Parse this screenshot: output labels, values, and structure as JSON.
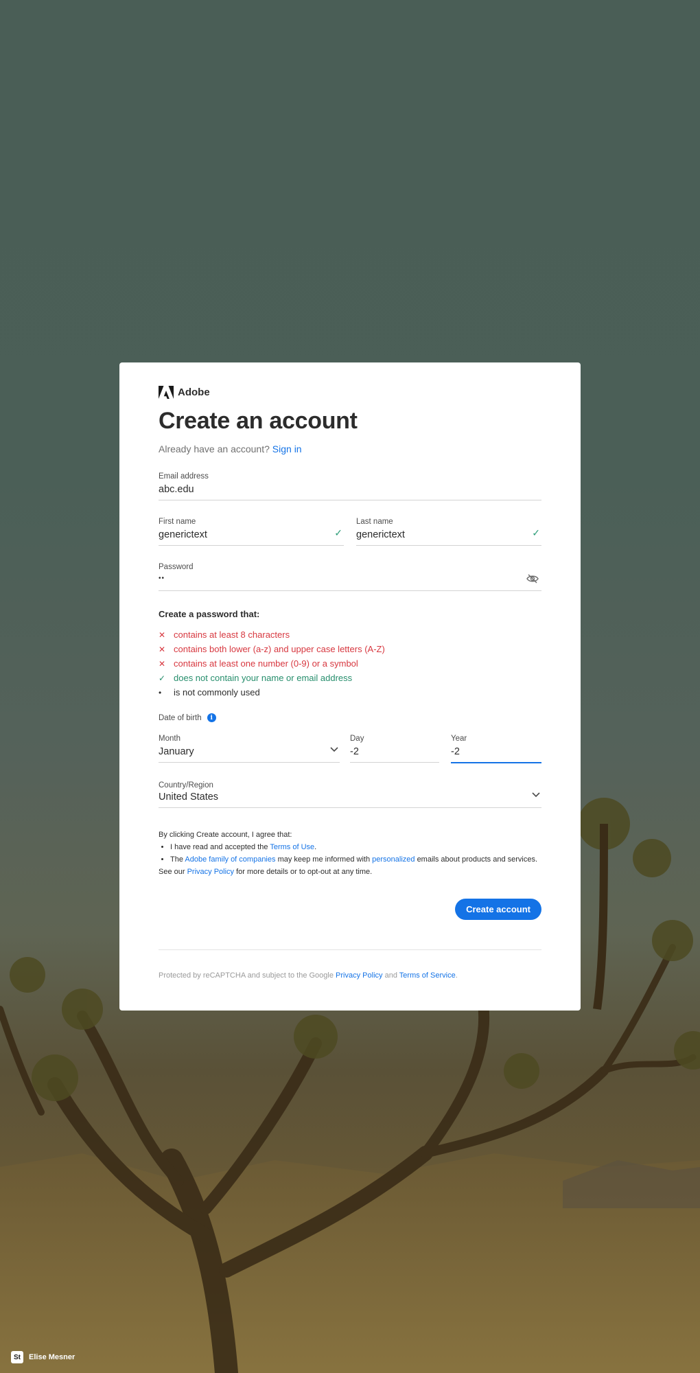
{
  "brand": {
    "name": "Adobe"
  },
  "title": "Create an account",
  "signin": {
    "prompt": "Already have an account?",
    "link": "Sign in"
  },
  "email": {
    "label": "Email address",
    "value": "abc.edu"
  },
  "first_name": {
    "label": "First name",
    "value": "generictext"
  },
  "last_name": {
    "label": "Last name",
    "value": "generictext"
  },
  "password": {
    "label": "Password",
    "value": "••"
  },
  "password_rules": {
    "title": "Create a password that:",
    "items": [
      {
        "mark": "✕",
        "text": "contains at least 8 characters",
        "status": "fail"
      },
      {
        "mark": "✕",
        "text": "contains both lower (a-z) and upper case letters (A-Z)",
        "status": "fail"
      },
      {
        "mark": "✕",
        "text": "contains at least one number (0-9) or a symbol",
        "status": "fail"
      },
      {
        "mark": "✓",
        "text": "does not contain your name or email address",
        "status": "pass"
      },
      {
        "mark": "•",
        "text": "is not commonly used",
        "status": "neutral"
      }
    ]
  },
  "dob": {
    "label": "Date of birth",
    "month": {
      "label": "Month",
      "value": "January"
    },
    "day": {
      "label": "Day",
      "value": "-2"
    },
    "year": {
      "label": "Year",
      "value": "-2"
    }
  },
  "country": {
    "label": "Country/Region",
    "value": "United States"
  },
  "terms": {
    "intro": "By clicking Create account, I agree that:",
    "item1_prefix": "I have read and accepted the",
    "item1_link": "Terms of Use",
    "item1_suffix": ".",
    "item2_prefix": "The",
    "item2_link1": "Adobe family of companies",
    "item2_mid": "may keep me informed with",
    "item2_link2": "personalized",
    "item2_suffix": "emails about products and services.",
    "see_prefix": "See our",
    "see_link": "Privacy Policy",
    "see_suffix": "for more details or to opt-out at any time."
  },
  "create_button": "Create account",
  "recaptcha": {
    "prefix": "Protected by reCAPTCHA and subject to the Google",
    "privacy": "Privacy Policy",
    "and": "and",
    "tos": "Terms of Service",
    "end": "."
  },
  "credit": {
    "badge": "St",
    "name": "Elise Mesner"
  },
  "colors": {
    "accent": "#1473e6",
    "error": "#d7373f",
    "success": "#268e6c"
  }
}
